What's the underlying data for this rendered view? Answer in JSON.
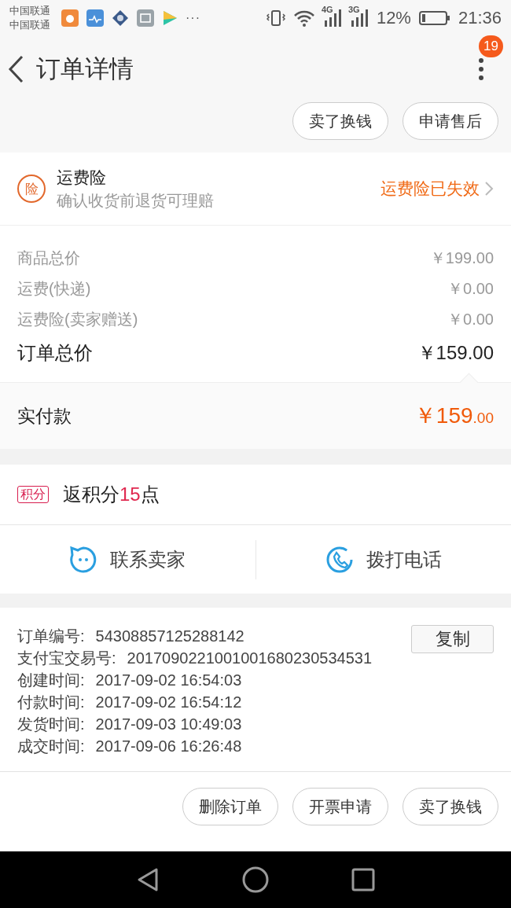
{
  "status_bar": {
    "carriers": [
      "中国联通",
      "中国联通"
    ],
    "more": "···",
    "network_a": "4G",
    "network_b": "3G",
    "battery": "12%",
    "time": "21:36"
  },
  "header": {
    "title": "订单详情",
    "badge": "19"
  },
  "top_actions": [
    "卖了换钱",
    "申请售后"
  ],
  "insurance": {
    "badge": "险",
    "title": "运费险",
    "subtitle": "确认收货前退货可理赔",
    "status": "运费险已失效"
  },
  "price_rows": [
    {
      "label": "商品总价",
      "value": "￥199.00",
      "kind": "minor"
    },
    {
      "label": "运费(快递)",
      "value": "￥0.00",
      "kind": "minor"
    },
    {
      "label": "运费险(卖家赠送)",
      "value": "￥0.00",
      "kind": "minor"
    },
    {
      "label": "订单总价",
      "value": "￥159.00",
      "kind": "total"
    }
  ],
  "paid": {
    "label": "实付款",
    "amount": "￥159",
    "decimals": ".00"
  },
  "points": {
    "tag": "积分",
    "prefix": "返积分",
    "number": "15",
    "suffix": "点"
  },
  "contact": [
    {
      "label": "联系卖家",
      "kind": "chat"
    },
    {
      "label": "拨打电话",
      "kind": "phone"
    }
  ],
  "order_info": {
    "copy_button": "复制",
    "rows": [
      {
        "label": "订单编号:",
        "value": "54308857125288142"
      },
      {
        "label": "支付宝交易号:",
        "value": "2017090221001001680230534531"
      },
      {
        "label": "创建时间:",
        "value": "2017-09-02 16:54:03"
      },
      {
        "label": "付款时间:",
        "value": "2017-09-02 16:54:12"
      },
      {
        "label": "发货时间:",
        "value": "2017-09-03 10:49:03"
      },
      {
        "label": "成交时间:",
        "value": "2017-09-06 16:26:48"
      }
    ]
  },
  "bottom_actions": [
    "删除订单",
    "开票申请",
    "卖了换钱"
  ]
}
